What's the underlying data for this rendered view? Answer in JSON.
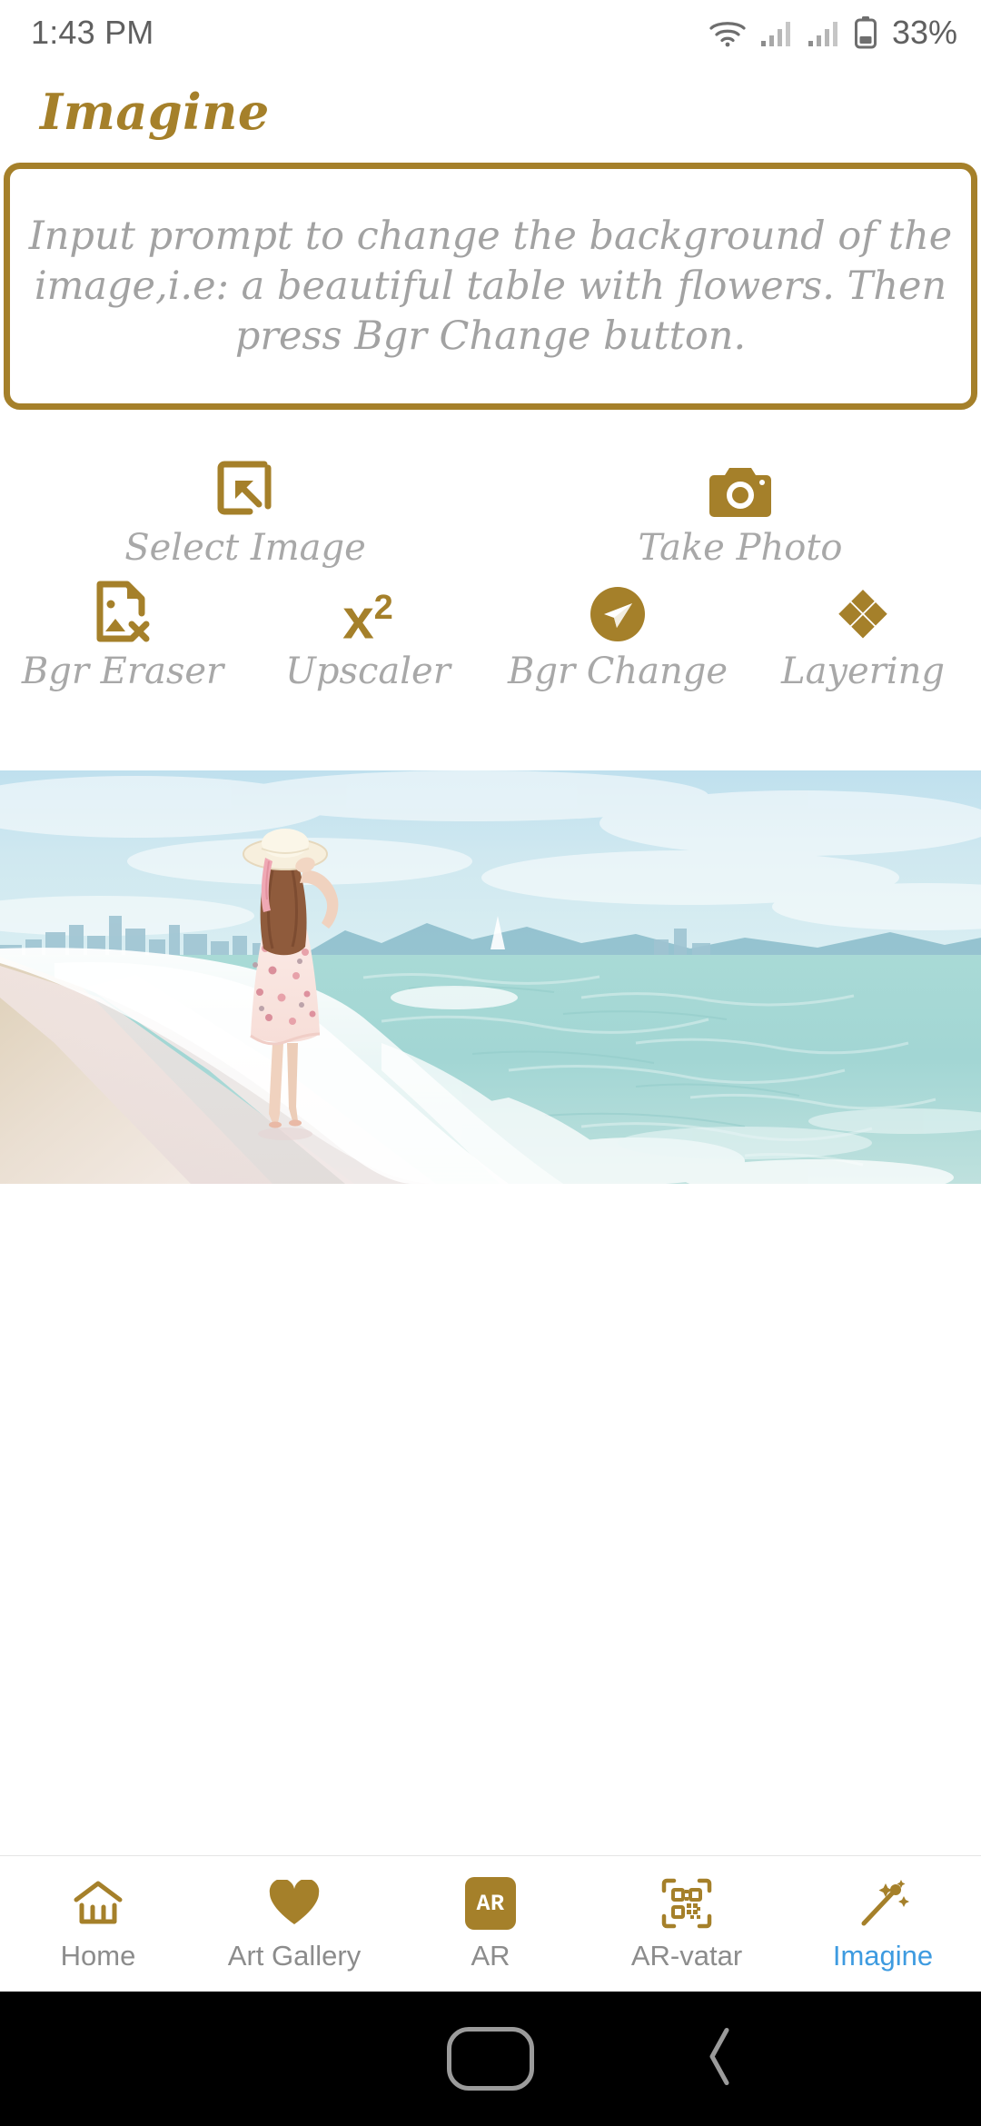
{
  "status_bar": {
    "time": "1:43 PM",
    "battery_percent": "33%",
    "icons": [
      "wifi-icon",
      "signal-icon-1",
      "signal-icon-2",
      "battery-icon"
    ]
  },
  "header": {
    "app_title": "Imagine"
  },
  "prompt": {
    "placeholder": "Input prompt to change the background of the image,i.e: a beautiful table with flowers. Then press Bgr Change button.",
    "value": "",
    "border_color": "#A5802A"
  },
  "tools": [
    {
      "id": "select-image",
      "label": "Select Image",
      "icon": "select-image-icon"
    },
    {
      "id": "take-photo",
      "label": "Take Photo",
      "icon": "camera-icon"
    },
    {
      "id": "bgr-eraser",
      "label": "Bgr Eraser",
      "icon": "image-remove-icon"
    },
    {
      "id": "upscaler",
      "label": "Upscaler",
      "icon": "x-squared-icon",
      "glyph_base": "x",
      "glyph_exp": "2"
    },
    {
      "id": "bgr-change",
      "label": "Bgr Change",
      "icon": "send-circle-icon"
    },
    {
      "id": "layering",
      "label": "Layering",
      "icon": "layers-diamond-icon"
    }
  ],
  "preview": {
    "alt": "Woman in floral dress and sun hat walking along a beach shoreline with city skyline on the horizon"
  },
  "bottom_nav": {
    "active": "Imagine",
    "items": [
      {
        "label": "Home",
        "icon": "home-icon"
      },
      {
        "label": "Art Gallery",
        "icon": "heart-icon"
      },
      {
        "label": "AR",
        "icon": "ar-badge-icon",
        "badge_text": "AR"
      },
      {
        "label": "AR-vatar",
        "icon": "qr-code-icon"
      },
      {
        "label": "Imagine",
        "icon": "magic-wand-icon"
      }
    ]
  },
  "system_nav": {
    "home_label": "home-pill",
    "back_label": "back-chevron"
  },
  "colors": {
    "gold": "#A5802A",
    "muted_text": "#A8A8A8",
    "active_blue": "#3E9BE0"
  }
}
